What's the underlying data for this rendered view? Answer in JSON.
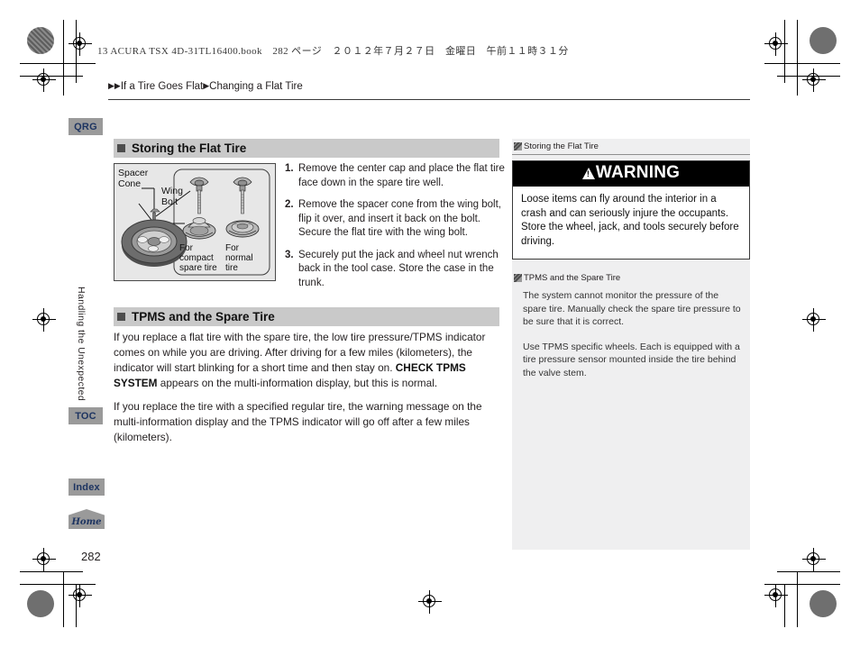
{
  "book_line": "13 ACURA TSX 4D-31TL16400.book　282 ページ　２０１２年７月２７日　金曜日　午前１１時３１分",
  "breadcrumb": {
    "arrow1": "▶",
    "arrow2": "▶",
    "part1": "If a Tire Goes Flat",
    "arrow3": "▶",
    "part2": "Changing a Flat Tire"
  },
  "tabs": {
    "qrg": "QRG",
    "toc": "TOC",
    "index": "Index",
    "home": "Home"
  },
  "chapter_tab": "Handling the Unexpected",
  "page_number": "282",
  "sections": [
    {
      "title": "Storing the Flat Tire"
    },
    {
      "title": "TPMS and the Spare Tire"
    }
  ],
  "figure": {
    "label_spacer_cone": "Spacer\nCone",
    "label_wing_bolt": "Wing\nBolt",
    "caption_compact": "For\ncompact\nspare tire",
    "caption_normal": "For\nnormal\ntire"
  },
  "steps": [
    {
      "num": "1.",
      "text": "Remove the center cap and place the flat tire face down in the spare tire well."
    },
    {
      "num": "2.",
      "text": "Remove the spacer cone from the wing bolt, flip it over, and insert it back on the bolt. Secure the flat tire with the wing bolt."
    },
    {
      "num": "3.",
      "text": "Securely put the jack and wheel nut wrench back in the tool case. Store the case in the trunk."
    }
  ],
  "tpms": {
    "para1_a": "If you replace a flat tire with the spare tire, the low tire pressure/TPMS indicator comes on while you are driving. After driving for a few miles (kilometers), the indicator will start blinking for a short time and then stay on. ",
    "para1_bold": "CHECK TPMS SYSTEM",
    "para1_b": " appears on the multi-information display, but this is normal.",
    "para2": "If you replace the tire with a specified regular tire, the warning message on the multi-information display and the TPMS indicator will go off after a few miles (kilometers)."
  },
  "sidebar": {
    "head1": "Storing the Flat Tire",
    "warning_title": "WARNING",
    "warning_body_1": "Loose items can fly around the interior in a crash and can seriously injure the occupants.",
    "warning_body_2": "Store the wheel, jack, and tools securely before driving.",
    "head2": "TPMS and the Spare Tire",
    "note1": "The system cannot monitor the pressure of the spare tire. Manually check the spare tire pressure to be sure that it is correct.",
    "note2": "Use TPMS specific wheels. Each is equipped with a tire pressure sensor mounted inside the tire behind the valve stem."
  },
  "colors": {
    "tab_grey": "#9a9a9a",
    "tab_text": "#1d3461",
    "section_header_grey": "#c9c9c9",
    "sidebar_grey": "#efeff0",
    "warning_black": "#000000"
  }
}
